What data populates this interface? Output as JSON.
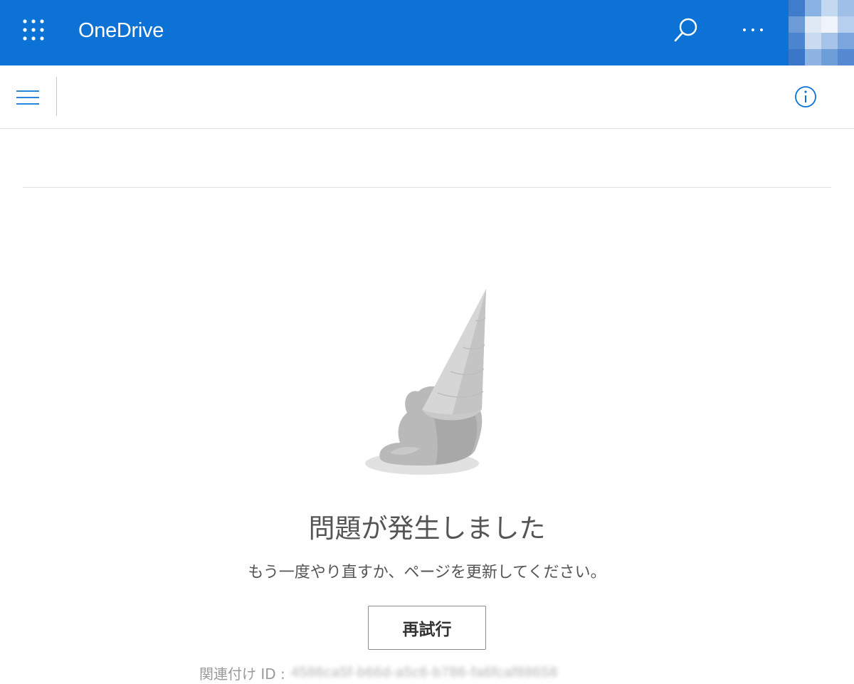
{
  "header": {
    "app_name": "OneDrive",
    "brand_color": "#0c72d6",
    "icons": [
      "app-launcher-icon",
      "search-icon",
      "more-icon"
    ],
    "avatar": "profile picture (pixelated)"
  },
  "command_bar": {
    "icons": [
      "hamburger-menu-icon",
      "info-icon"
    ]
  },
  "error": {
    "illustration": "dropped-ice-cream-cone",
    "title": "問題が発生しました",
    "message": "もう一度やり直すか、ページを更新してください。",
    "retry_label": "再試行",
    "correlation_label": "関連付け ID :",
    "correlation_value": "4586ca5f-b66d-a5c6-b786-fa6fcaf88658"
  }
}
